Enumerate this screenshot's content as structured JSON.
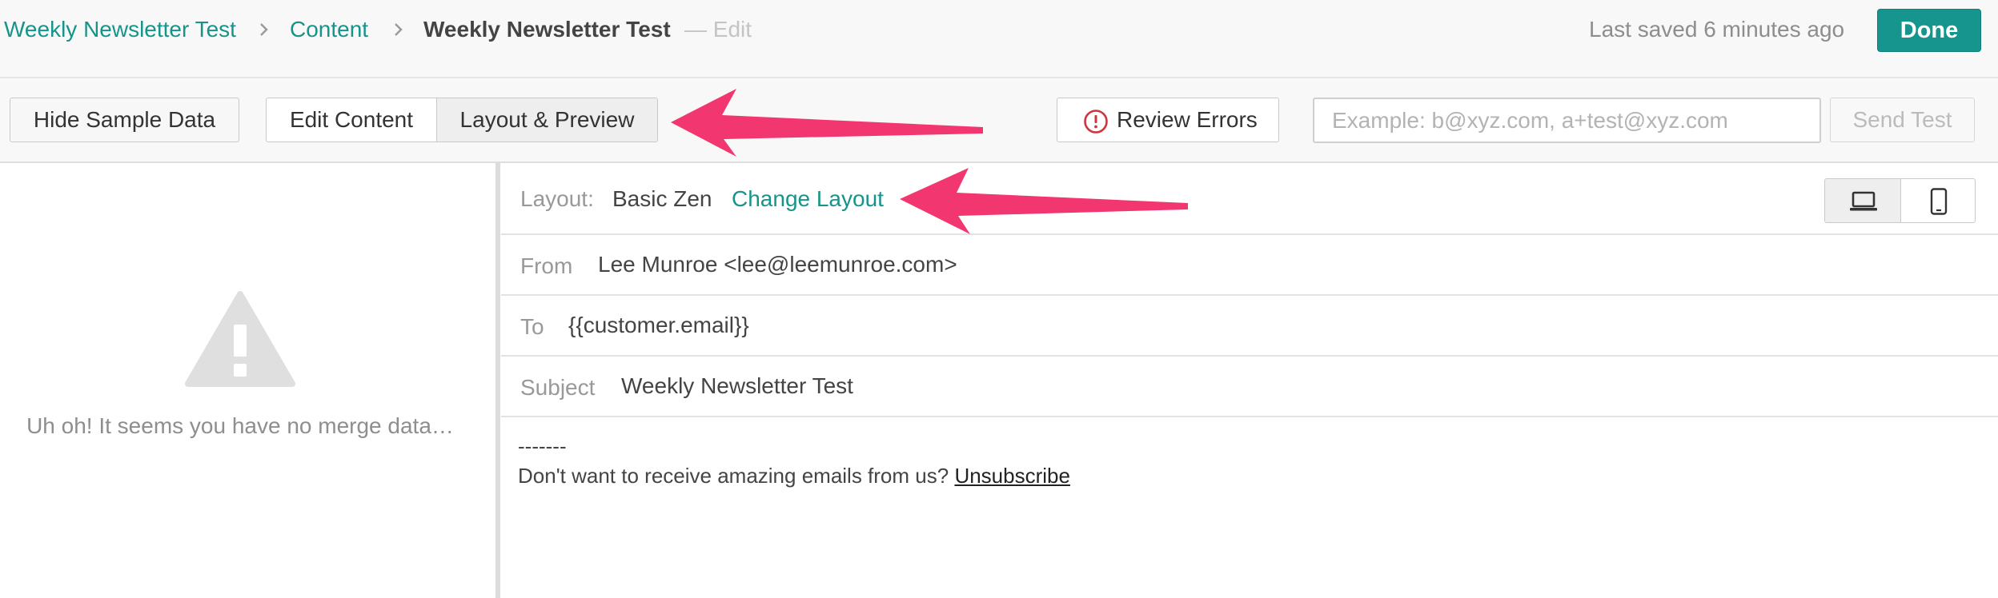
{
  "header": {
    "breadcrumb": [
      "Weekly Newsletter Test",
      "Content",
      "Weekly Newsletter Test"
    ],
    "edit_suffix": "— Edit",
    "last_saved": "Last saved 6 minutes ago",
    "done_label": "Done"
  },
  "toolbar": {
    "hide_sample_label": "Hide Sample Data",
    "tabs": [
      "Edit Content",
      "Layout & Preview"
    ],
    "active_tab": "Layout & Preview",
    "review_errors_label": "Review Errors",
    "test_email_placeholder": "Example: b@xyz.com, a+test@xyz.com",
    "test_email_value": "",
    "send_test_label": "Send Test"
  },
  "left_panel": {
    "message": "Uh oh! It seems you have no merge data…"
  },
  "preview": {
    "layout_label": "Layout:",
    "layout_name": "Basic Zen",
    "change_layout_label": "Change Layout",
    "from_label": "From",
    "from_value": "Lee Munroe <lee@leemunroe.com>",
    "to_label": "To",
    "to_value": "{{customer.email}}",
    "subject_label": "Subject",
    "subject_value": "Weekly Newsletter Test",
    "footer_dashes": "-------",
    "footer_text": "Don't want to receive amazing emails from us?",
    "unsubscribe_label": "Unsubscribe"
  },
  "icons": {
    "breadcrumb_separator": "chevron-right-icon",
    "review_errors": "alert-circle-icon",
    "no_data": "warning-triangle-icon",
    "desktop_view": "laptop-icon",
    "mobile_view": "mobile-phone-icon",
    "annotation": "pink-arrow"
  },
  "colors": {
    "accent": "#17948a",
    "done_button": "#15958e",
    "error_icon": "#d0343c",
    "annotation_arrow": "#f2366f"
  }
}
